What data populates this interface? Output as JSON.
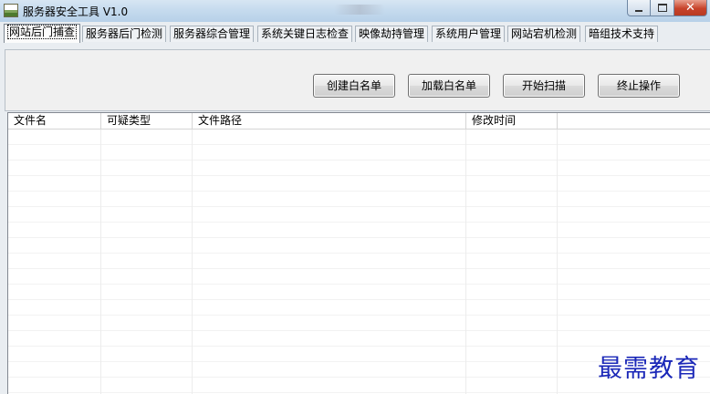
{
  "window": {
    "title": "服务器安全工具 V1.0"
  },
  "tabs": [
    {
      "label": "网站后门捕查",
      "active": true
    },
    {
      "label": "服务器后门检测",
      "active": false
    },
    {
      "label": "服务器综合管理",
      "active": false
    },
    {
      "label": "系统关键日志检查",
      "active": false
    },
    {
      "label": "映像劫持管理",
      "active": false
    },
    {
      "label": "系统用户管理",
      "active": false
    },
    {
      "label": "网站宕机检测",
      "active": false
    },
    {
      "label": "暗组技术支持",
      "active": false
    }
  ],
  "toolbar": {
    "create_whitelist": "创建白名单",
    "load_whitelist": "加载白名单",
    "start_scan": "开始扫描",
    "stop": "终止操作"
  },
  "table": {
    "columns": [
      "文件名",
      "可疑类型",
      "文件路径",
      "修改时间"
    ],
    "rows": []
  },
  "watermark": "最需教育",
  "colors": {
    "titlebar": "#c6dbee",
    "close_button": "#c7432a",
    "watermark": "#1b28b8"
  }
}
